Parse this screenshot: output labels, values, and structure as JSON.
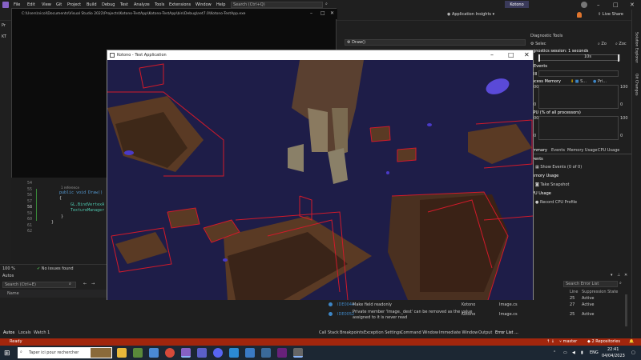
{
  "menu": {
    "items": [
      "File",
      "Edit",
      "View",
      "Git",
      "Project",
      "Build",
      "Debug",
      "Test",
      "Analyze",
      "Tools",
      "Extensions",
      "Window",
      "Help"
    ],
    "search_placeholder": "Search (Ctrl+Q)",
    "project_name": "Kotono"
  },
  "toolbar": {
    "app_insights": "Application Insights",
    "live_share": "Live Share"
  },
  "console": {
    "path": "C:\\Users\\nicol\\Documents\\Visual Studio 2022\\Projects\\Kotono-TestApp\\Kotono-TestApp\\bin\\Debug\\net7.0\\Kotono-TestApp.exe"
  },
  "editor": {
    "line_numbers": [
      "54",
      "55",
      "56",
      "57",
      "58",
      "59",
      "60",
      "61",
      "62"
    ],
    "reference": "1 reference",
    "code_line1": "public void Draw()",
    "code_line2": "{",
    "code_line3": "GL.BindVertexA",
    "code_line4": "TextureManager",
    "code_line5": "}",
    "code_line6": "}",
    "zoom": "100 %",
    "issues": "No issues found"
  },
  "dropdown": {
    "value": "Draw()"
  },
  "autos": {
    "title": "Autos",
    "search_placeholder": "Search (Ctrl+E)",
    "col_name": "Name"
  },
  "bottom_left_tabs": [
    "Autos",
    "Locals",
    "Watch 1"
  ],
  "diagnostic": {
    "title": "Diagnostic Tools",
    "select_tools": "Selec",
    "zoom_in": "Zo",
    "zoom_out": "Zoc",
    "session": "agnostics session: 1 seconds",
    "time_label": "10s",
    "events_hdr": "Events",
    "pause": "III",
    "process_memory": "rocess Memory",
    "snap": "S...",
    "pri": "Pri...",
    "mem_top": "100",
    "mem_bottom": "0",
    "mem_left_top": "00",
    "mem_left_bottom": "0",
    "cpu_hdr": "CPU (% of all processors)",
    "cpu_top": "100",
    "cpu_bottom": "0",
    "cpu_left_top": "00",
    "cpu_left_bottom": "0",
    "tabs": [
      "ummary",
      "Events",
      "Memory Usage",
      "CPU Usage"
    ],
    "events_section": "vents",
    "show_events": "Show Events (0 of 0)",
    "memory_usage": "emory Usage",
    "take_snapshot": "Take Snapshot",
    "cpu_usage": "PU Usage",
    "record_cpu": "Record CPU Profile"
  },
  "side_tabs": [
    "Solution Explorer",
    "Git Changes"
  ],
  "app": {
    "title": "Kotono - Test Application"
  },
  "error_list": {
    "search_placeholder": "Search Error List",
    "col_line": "Line",
    "col_suppression": "Suppression State",
    "rows": [
      {
        "code": "IDE0044",
        "desc": "Make field readonly",
        "project": "Kotono",
        "file": "Image.cs",
        "line": "27",
        "state": "Active"
      },
      {
        "code": "IDE0052",
        "desc": "Private member 'Image._dest' can be removed as the value",
        "desc2": "assigned to it is never read",
        "project": "Kotono",
        "file": "Image.cs",
        "line": "25",
        "state": "Active"
      }
    ],
    "partial_row": {
      "code": "IDE0044",
      "desc": "Make field readonly",
      "line": "25",
      "state": "Active"
    }
  },
  "bottom_tabs": [
    "Call Stack",
    "Breakpoints",
    "Exception Settings",
    "Command Window",
    "Immediate Window",
    "Output",
    "Error List ..."
  ],
  "status": {
    "ready": "Ready",
    "arrows": "↑ ↓",
    "branch": "master",
    "repos": "2 Repositories"
  },
  "taskbar": {
    "search_placeholder": "Taper ici pour rechercher",
    "lang": "ENG",
    "time": "22:41",
    "date": "04/04/2023"
  },
  "colors": {
    "accent": "#a1260d",
    "scene_bg": "#1e1d48",
    "box_edge": "#d11a2a"
  }
}
